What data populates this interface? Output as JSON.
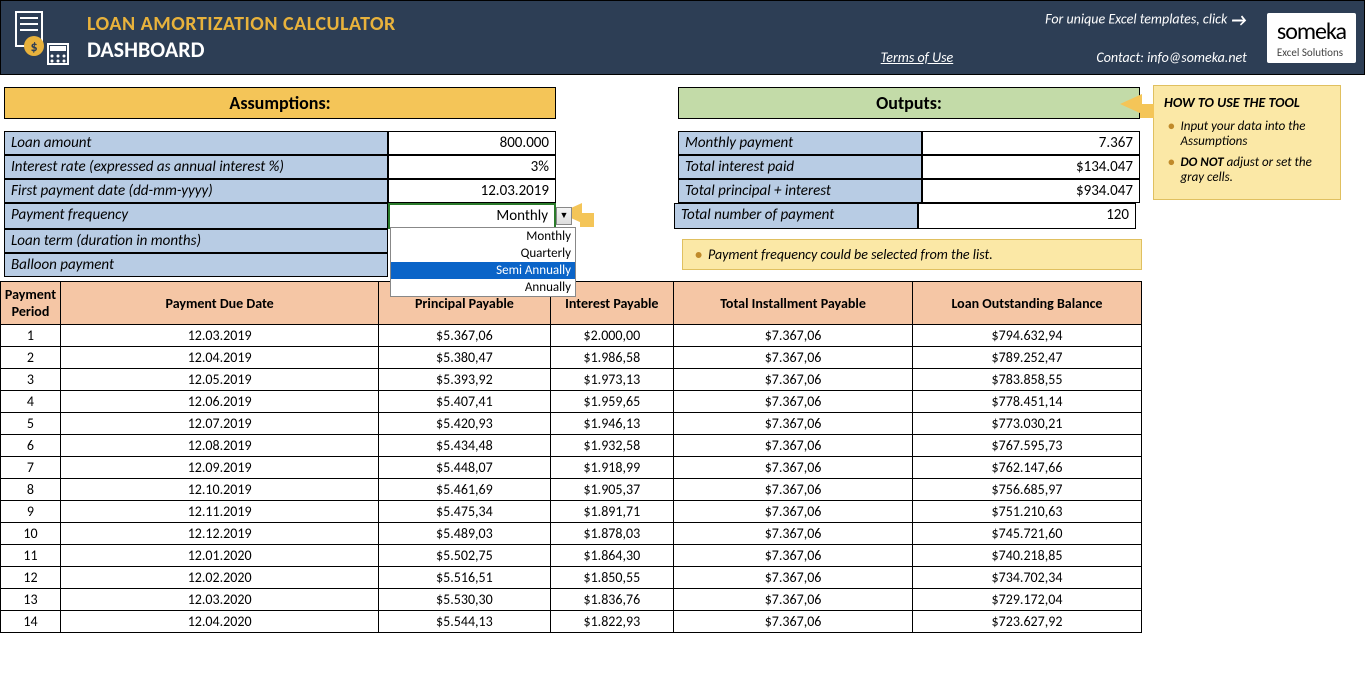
{
  "header": {
    "title": "LOAN AMORTIZATION CALCULATOR",
    "subtitle": "DASHBOARD",
    "promo": "For unique Excel templates, click",
    "terms": "Terms of Use",
    "contact": "Contact: info@someka.net",
    "logo_main": "someka",
    "logo_sub": "Excel Solutions"
  },
  "sections": {
    "assumptions": "Assumptions:",
    "outputs": "Outputs:"
  },
  "assumptions": {
    "loan_amount_label": "Loan amount",
    "loan_amount_val": "800.000",
    "interest_label": "Interest rate (expressed as annual interest %)",
    "interest_val": "3%",
    "first_pay_label": "First payment date (dd-mm-yyyy)",
    "first_pay_val": "12.03.2019",
    "freq_label": "Payment frequency",
    "freq_val": "Monthly",
    "term_label": "Loan term (duration in months)",
    "term_val": "",
    "balloon_label": "Balloon payment",
    "balloon_val": ""
  },
  "dropdown": {
    "opt1": "Monthly",
    "opt2": "Quarterly",
    "opt3": "Semi Annually",
    "opt4": "Annually"
  },
  "outputs": {
    "monthly_label": "Monthly payment",
    "monthly_val": "7.367",
    "total_int_label": "Total interest paid",
    "total_int_val": "$134.047",
    "total_pi_label": "Total principal + interest",
    "total_pi_val": "$934.047",
    "num_pay_label": "Total number of payment",
    "num_pay_val": "120"
  },
  "hint": "Payment frequency could be selected from the list.",
  "note": {
    "title": "HOW TO USE THE TOOL",
    "tip1": "Input your data into the Assumptions",
    "tip2_pre": "DO NOT",
    "tip2_post": " adjust or set the gray cells."
  },
  "table": {
    "headers": {
      "period": "Payment Period",
      "date": "Payment Due Date",
      "principal": "Principal Payable",
      "interest": "Interest Payable",
      "total": "Total Installment Payable",
      "balance": "Loan Outstanding Balance"
    },
    "rows": [
      {
        "p": "1",
        "d": "12.03.2019",
        "pr": "$5.367,06",
        "in": "$2.000,00",
        "to": "$7.367,06",
        "ba": "$794.632,94"
      },
      {
        "p": "2",
        "d": "12.04.2019",
        "pr": "$5.380,47",
        "in": "$1.986,58",
        "to": "$7.367,06",
        "ba": "$789.252,47"
      },
      {
        "p": "3",
        "d": "12.05.2019",
        "pr": "$5.393,92",
        "in": "$1.973,13",
        "to": "$7.367,06",
        "ba": "$783.858,55"
      },
      {
        "p": "4",
        "d": "12.06.2019",
        "pr": "$5.407,41",
        "in": "$1.959,65",
        "to": "$7.367,06",
        "ba": "$778.451,14"
      },
      {
        "p": "5",
        "d": "12.07.2019",
        "pr": "$5.420,93",
        "in": "$1.946,13",
        "to": "$7.367,06",
        "ba": "$773.030,21"
      },
      {
        "p": "6",
        "d": "12.08.2019",
        "pr": "$5.434,48",
        "in": "$1.932,58",
        "to": "$7.367,06",
        "ba": "$767.595,73"
      },
      {
        "p": "7",
        "d": "12.09.2019",
        "pr": "$5.448,07",
        "in": "$1.918,99",
        "to": "$7.367,06",
        "ba": "$762.147,66"
      },
      {
        "p": "8",
        "d": "12.10.2019",
        "pr": "$5.461,69",
        "in": "$1.905,37",
        "to": "$7.367,06",
        "ba": "$756.685,97"
      },
      {
        "p": "9",
        "d": "12.11.2019",
        "pr": "$5.475,34",
        "in": "$1.891,71",
        "to": "$7.367,06",
        "ba": "$751.210,63"
      },
      {
        "p": "10",
        "d": "12.12.2019",
        "pr": "$5.489,03",
        "in": "$1.878,03",
        "to": "$7.367,06",
        "ba": "$745.721,60"
      },
      {
        "p": "11",
        "d": "12.01.2020",
        "pr": "$5.502,75",
        "in": "$1.864,30",
        "to": "$7.367,06",
        "ba": "$740.218,85"
      },
      {
        "p": "12",
        "d": "12.02.2020",
        "pr": "$5.516,51",
        "in": "$1.850,55",
        "to": "$7.367,06",
        "ba": "$734.702,34"
      },
      {
        "p": "13",
        "d": "12.03.2020",
        "pr": "$5.530,30",
        "in": "$1.836,76",
        "to": "$7.367,06",
        "ba": "$729.172,04"
      },
      {
        "p": "14",
        "d": "12.04.2020",
        "pr": "$5.544,13",
        "in": "$1.822,93",
        "to": "$7.367,06",
        "ba": "$723.627,92"
      }
    ]
  }
}
